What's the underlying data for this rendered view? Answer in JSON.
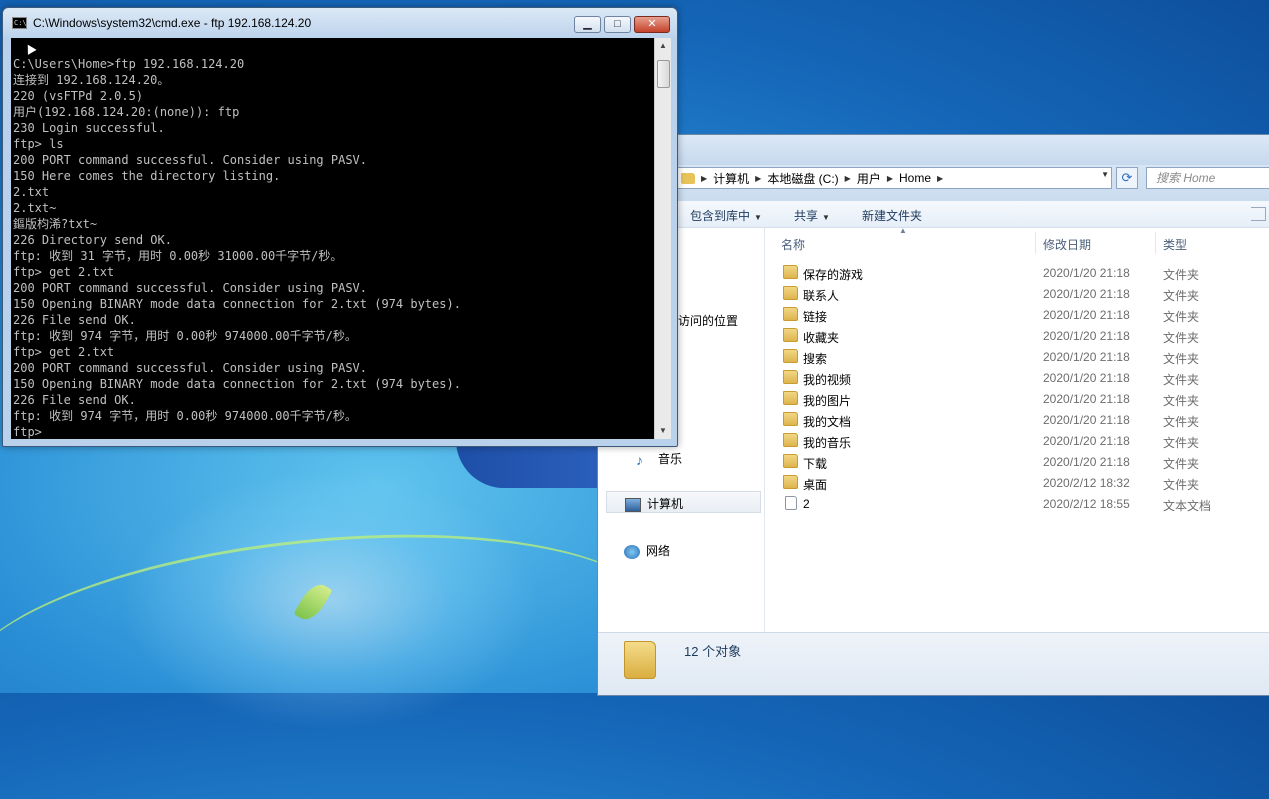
{
  "cmd": {
    "title": "C:\\Windows\\system32\\cmd.exe - ftp  192.168.124.20",
    "icon_text": "C:\\",
    "buttons": {
      "minimize": "▁",
      "maximize": "□",
      "close": "✕"
    },
    "lines": [
      "C:\\Users\\Home>ftp 192.168.124.20",
      "连接到 192.168.124.20。",
      "220 (vsFTPd 2.0.5)",
      "用户(192.168.124.20:(none)): ftp",
      "230 Login successful.",
      "ftp> ls",
      "200 PORT command successful. Consider using PASV.",
      "150 Here comes the directory listing.",
      "2.txt",
      "2.txt~",
      "鏂版枃浠?txt~",
      "226 Directory send OK.",
      "ftp: 收到 31 字节，用时 0.00秒 31000.00千字节/秒。",
      "ftp> get 2.txt",
      "200 PORT command successful. Consider using PASV.",
      "150 Opening BINARY mode data connection for 2.txt (974 bytes).",
      "226 File send OK.",
      "ftp: 收到 974 字节，用时 0.00秒 974000.00千字节/秒。",
      "ftp> get 2.txt",
      "200 PORT command successful. Consider using PASV.",
      "150 Opening BINARY mode data connection for 2.txt (974 bytes).",
      "226 File send OK.",
      "ftp: 收到 974 字节，用时 0.00秒 974000.00千字节/秒。",
      "ftp>"
    ]
  },
  "explorer": {
    "breadcrumb": [
      "计算机",
      "本地磁盘 (C:)",
      "用户",
      "Home"
    ],
    "search_placeholder": "搜索 Home",
    "toolbar": {
      "include_library": "包含到库中",
      "share": "共享",
      "new_folder": "新建文件夹"
    },
    "nav": {
      "recent_places": "访问的位置",
      "music": "音乐",
      "computer": "计算机",
      "network": "网络"
    },
    "columns": {
      "name": "名称",
      "modified": "修改日期",
      "type": "类型"
    },
    "files": [
      {
        "name": "保存的游戏",
        "date": "2020/1/20 21:18",
        "type": "文件夹",
        "icon": "folder-icon"
      },
      {
        "name": "联系人",
        "date": "2020/1/20 21:18",
        "type": "文件夹",
        "icon": "folder-icon"
      },
      {
        "name": "链接",
        "date": "2020/1/20 21:18",
        "type": "文件夹",
        "icon": "folder-icon"
      },
      {
        "name": "收藏夹",
        "date": "2020/1/20 21:18",
        "type": "文件夹",
        "icon": "folder-icon"
      },
      {
        "name": "搜索",
        "date": "2020/1/20 21:18",
        "type": "文件夹",
        "icon": "folder-icon"
      },
      {
        "name": "我的视频",
        "date": "2020/1/20 21:18",
        "type": "文件夹",
        "icon": "folder-icon"
      },
      {
        "name": "我的图片",
        "date": "2020/1/20 21:18",
        "type": "文件夹",
        "icon": "folder-icon"
      },
      {
        "name": "我的文档",
        "date": "2020/1/20 21:18",
        "type": "文件夹",
        "icon": "folder-icon"
      },
      {
        "name": "我的音乐",
        "date": "2020/1/20 21:18",
        "type": "文件夹",
        "icon": "folder-icon"
      },
      {
        "name": "下载",
        "date": "2020/1/20 21:18",
        "type": "文件夹",
        "icon": "folder-icon"
      },
      {
        "name": "桌面",
        "date": "2020/2/12 18:32",
        "type": "文件夹",
        "icon": "folder-icon"
      },
      {
        "name": "2",
        "date": "2020/2/12 18:55",
        "type": "文本文档",
        "icon": "text-file-icon"
      }
    ],
    "status": "12 个对象"
  }
}
